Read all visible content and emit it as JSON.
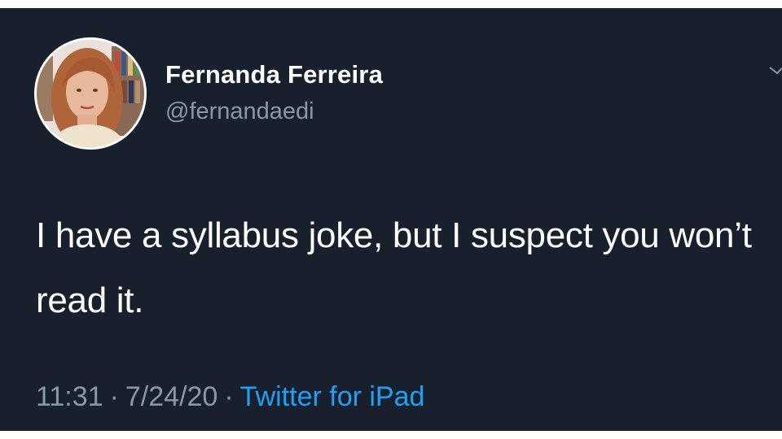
{
  "tweet": {
    "author": {
      "display_name": "Fernanda Ferreira",
      "handle": "@fernandaedi"
    },
    "text": "I have a syllabus joke, but I suspect you won’t read it.",
    "meta": {
      "time": "11:31",
      "date": "7/24/20",
      "separator": "·",
      "source": "Twitter for iPad"
    }
  },
  "colors": {
    "background": "#17202c",
    "text": "#ffffff",
    "secondary_text": "#8899a6",
    "link": "#1da1f2"
  },
  "icons": {
    "menu": "chevron-down-icon"
  }
}
